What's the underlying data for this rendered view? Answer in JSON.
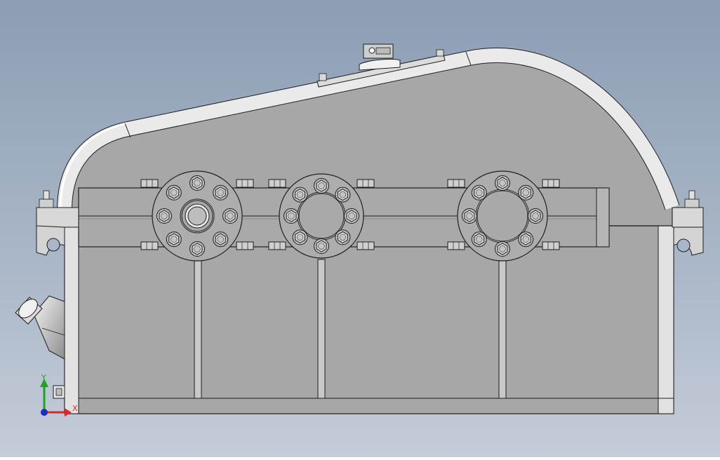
{
  "view": {
    "name": "gearbox-front-view",
    "background_top": "#8c9db4",
    "background_bottom": "#c4ccd8"
  },
  "part": {
    "body_color": "#a7a7a7",
    "edge_color": "#1e1e1e",
    "highlight_color": "#e6e6e6"
  },
  "triad": {
    "x_label": "X",
    "y_label": "Y",
    "x_color": "#d42a2a",
    "y_color": "#22a02a",
    "z_color": "#1b2fbf"
  }
}
